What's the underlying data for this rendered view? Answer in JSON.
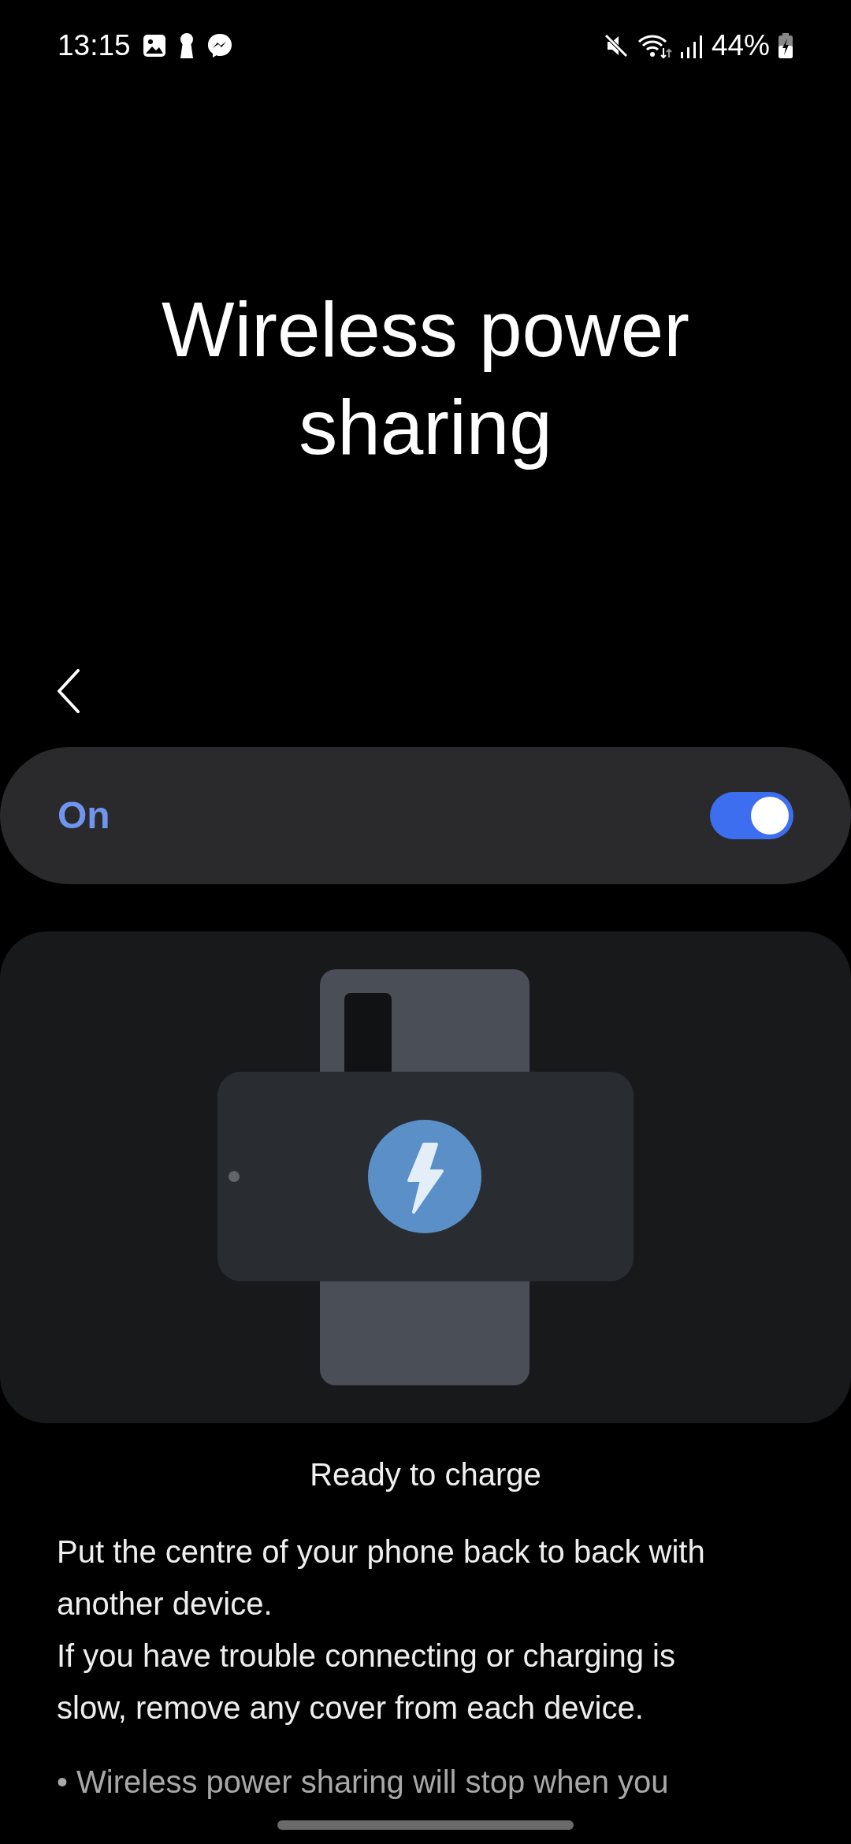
{
  "status_bar": {
    "time": "13:15",
    "battery": "44%"
  },
  "title": "Wireless power sharing",
  "switch": {
    "label": "On",
    "on": true
  },
  "status_text": "Ready to charge",
  "description": [
    "Put the centre of your phone back to back with another device.",
    "If you have trouble connecting or charging is slow, remove any cover from each device."
  ],
  "notes": [
    "• Wireless power sharing will stop when you"
  ]
}
